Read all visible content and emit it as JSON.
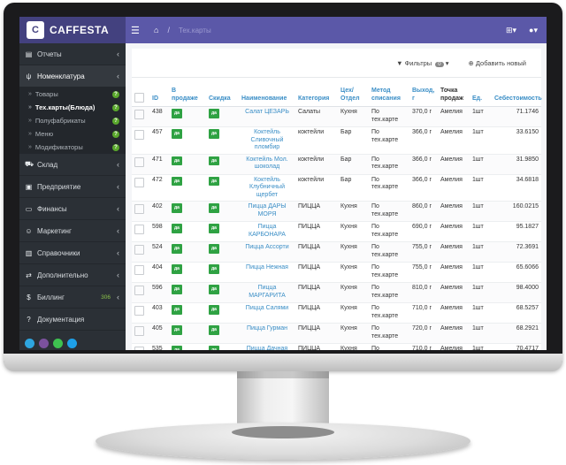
{
  "app": {
    "name": "CAFFESTA",
    "logo_text": "C"
  },
  "sidebar": {
    "items": [
      {
        "label": "Отчеты",
        "icon": "chart-icon"
      },
      {
        "label": "Номенклатура",
        "icon": "cutlery-icon"
      },
      {
        "label": "Склад",
        "icon": "truck-icon"
      },
      {
        "label": "Предприятие",
        "icon": "document-icon"
      },
      {
        "label": "Финансы",
        "icon": "wallet-icon"
      },
      {
        "label": "Маркетинг",
        "icon": "smile-icon"
      },
      {
        "label": "Справочники",
        "icon": "book-icon"
      },
      {
        "label": "Дополнительно",
        "icon": "swap-icon"
      },
      {
        "label": "Биллинг",
        "icon": "dollar-icon",
        "count": "306"
      },
      {
        "label": "Документация",
        "icon": "question-icon"
      }
    ],
    "submenu": [
      {
        "label": "Товары"
      },
      {
        "label": "Тех.карты(Блюда)"
      },
      {
        "label": "Полуфабрикаты"
      },
      {
        "label": "Меню"
      },
      {
        "label": "Модификаторы"
      }
    ],
    "social": [
      "telegram-icon",
      "viber-icon",
      "whatsapp-icon",
      "skype-icon"
    ]
  },
  "topbar": {
    "breadcrumb": "Тех.карты"
  },
  "toolbar": {
    "filters_label": "Фильтры",
    "filters_count": "0",
    "add_label": "Добавить новый"
  },
  "table": {
    "headers": {
      "id": "ID",
      "on_sale": "В продаже",
      "discount": "Скидка",
      "name": "Наименование",
      "category": "Категория",
      "workshop": "Цех/ Отдел",
      "method": "Метод списания",
      "yield": "Выход, г",
      "point": "Точка продаж",
      "unit": "Ед.",
      "cost": "Себестоимость"
    },
    "yes": "да",
    "rows": [
      {
        "id": "438",
        "name": "Салат ЦЕЗАРЬ",
        "category": "Салаты",
        "workshop": "Кухня",
        "method": "По тех.карте",
        "yield": "370,0 г",
        "point": "Амелия",
        "unit": "1шт",
        "cost": "71.1746"
      },
      {
        "id": "457",
        "name": "Коктейль Сливочный пломбир",
        "category": "коктейли",
        "workshop": "Бар",
        "method": "По тех.карте",
        "yield": "366,0 г",
        "point": "Амелия",
        "unit": "1шт",
        "cost": "33.6150"
      },
      {
        "id": "471",
        "name": "Коктейль Мол. шоколад",
        "category": "коктейли",
        "workshop": "Бар",
        "method": "По тех.карте",
        "yield": "366,0 г",
        "point": "Амелия",
        "unit": "1шт",
        "cost": "31.9850"
      },
      {
        "id": "472",
        "name": "Коктейль Клубничный щербет",
        "category": "коктейли",
        "workshop": "Бар",
        "method": "По тех.карте",
        "yield": "366,0 г",
        "point": "Амелия",
        "unit": "1шт",
        "cost": "34.6818"
      },
      {
        "id": "402",
        "name": "Пицца ДАРЫ МОРЯ",
        "category": "ПИЦЦА",
        "workshop": "Кухня",
        "method": "По тех.карте",
        "yield": "860,0 г",
        "point": "Амелия",
        "unit": "1шт",
        "cost": "160.0215"
      },
      {
        "id": "598",
        "name": "Пицца КАРБОНАРА",
        "category": "ПИЦЦА",
        "workshop": "Кухня",
        "method": "По тех.карте",
        "yield": "690,0 г",
        "point": "Амелия",
        "unit": "1шт",
        "cost": "95.1827"
      },
      {
        "id": "524",
        "name": "Пицца Ассорти",
        "category": "ПИЦЦА",
        "workshop": "Кухня",
        "method": "По тех.карте",
        "yield": "755,0 г",
        "point": "Амелия",
        "unit": "1шт",
        "cost": "72.3691"
      },
      {
        "id": "404",
        "name": "Пицца Нежная",
        "category": "ПИЦЦА",
        "workshop": "Кухня",
        "method": "По тех.карте",
        "yield": "755,0 г",
        "point": "Амелия",
        "unit": "1шт",
        "cost": "65.6066"
      },
      {
        "id": "596",
        "name": "Пицца МАРГАРИТА",
        "category": "ПИЦЦА",
        "workshop": "Кухня",
        "method": "По тех.карте",
        "yield": "810,0 г",
        "point": "Амелия",
        "unit": "1шт",
        "cost": "98.4000"
      },
      {
        "id": "403",
        "name": "Пицца Салями",
        "category": "ПИЦЦА",
        "workshop": "Кухня",
        "method": "По тех.карте",
        "yield": "710,0 г",
        "point": "Амелия",
        "unit": "1шт",
        "cost": "68.5257"
      },
      {
        "id": "405",
        "name": "Пицца Гурман",
        "category": "ПИЦЦА",
        "workshop": "Кухня",
        "method": "По тех.карте",
        "yield": "720,0 г",
        "point": "Амелия",
        "unit": "1шт",
        "cost": "68.2921"
      },
      {
        "id": "535",
        "name": "Пицца Дачная",
        "category": "ПИЦЦА",
        "workshop": "Кухня",
        "method": "По тех.карте",
        "yield": "710,0 г",
        "point": "Амелия",
        "unit": "1шт",
        "cost": "70.4717"
      },
      {
        "id": "595",
        "name": "Пицца 4 СЕЗОНА",
        "category": "ПИЦЦА",
        "workshop": "Кухня",
        "method": "По тех.карте",
        "yield": "790,0 г",
        "point": "Амелия",
        "unit": "1шт",
        "cost": "92.8797"
      }
    ]
  }
}
